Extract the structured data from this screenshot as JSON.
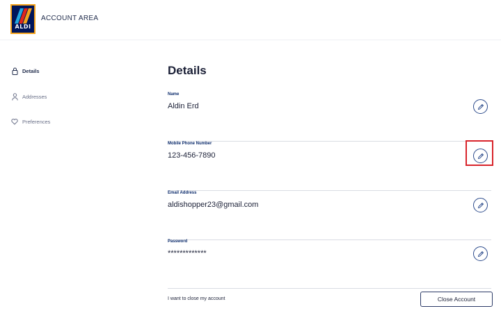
{
  "header": {
    "logo_text": "ALDI",
    "title": "ACCOUNT AREA"
  },
  "sidebar": {
    "items": [
      {
        "label": "Details",
        "icon": "lock-icon",
        "active": true
      },
      {
        "label": "Addresses",
        "icon": "user-icon",
        "active": false
      },
      {
        "label": "Preferences",
        "icon": "heart-icon",
        "active": false
      }
    ]
  },
  "main": {
    "title": "Details",
    "fields": [
      {
        "label": "Name",
        "value": "Aldin Erd"
      },
      {
        "label": "Mobile Phone Number",
        "value": "123-456-7890"
      },
      {
        "label": "Email Address",
        "value": "aldishopper23@gmail.com"
      },
      {
        "label": "Password",
        "value": "*************"
      }
    ],
    "close_account_text": "I want to close my account",
    "close_account_button": "Close Account"
  },
  "colors": {
    "brand_navy": "#00155a",
    "accent_border": "#2b4a8b",
    "highlight_red": "#d8232a"
  }
}
